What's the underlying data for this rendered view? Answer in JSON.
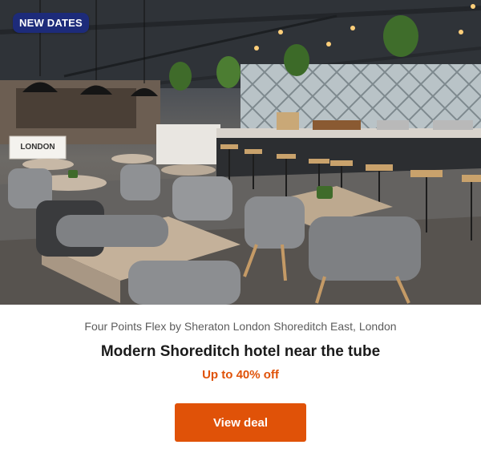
{
  "hero": {
    "badge": "NEW DATES",
    "image_alt": "Hotel café and dining area with tables, chairs and bar stools",
    "sign_text": "LONDON"
  },
  "deal": {
    "location": "Four Points Flex by Sheraton London Shoreditch East, London",
    "headline": "Modern Shoreditch hotel near the tube",
    "offer": "Up to 40% off",
    "cta_label": "View deal"
  },
  "colors": {
    "badge_bg": "#1d2b7a",
    "accent": "#e05208",
    "heading": "#1b1b1b",
    "subtext": "#5c5c5c"
  }
}
